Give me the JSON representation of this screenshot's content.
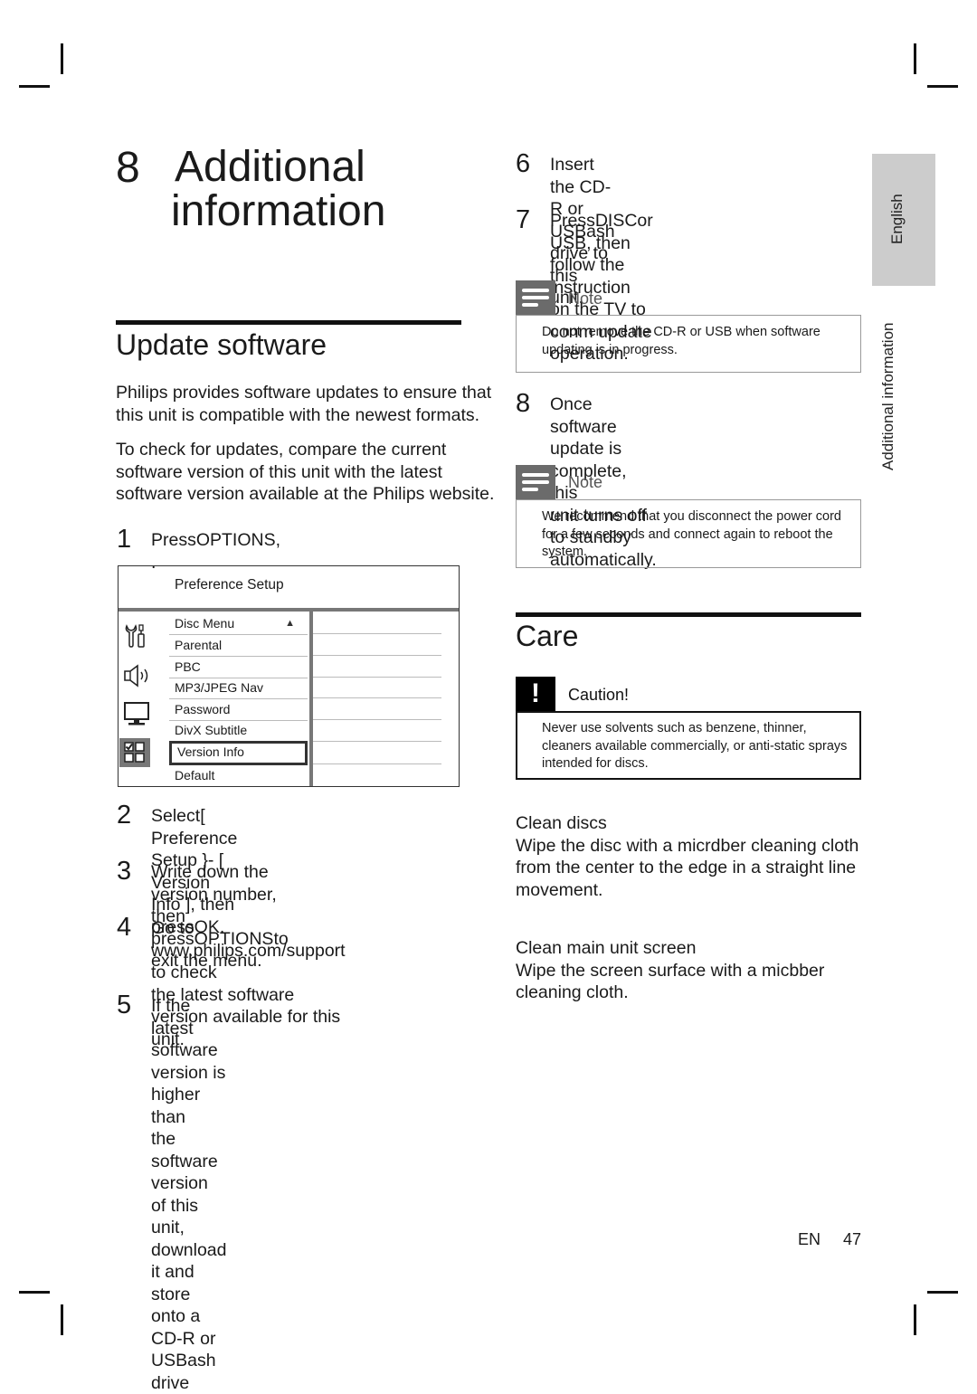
{
  "chapter": {
    "number": "8",
    "title_line1": "Additional",
    "title_line2": "information"
  },
  "side_tabs": {
    "language": "English",
    "section": "Additional information"
  },
  "update_software": {
    "title": "Update software",
    "para1_line1": "Philips provides software updates to ensure that",
    "para1_line2": "this unit is compatible with the newest formats.",
    "para2_line1": "To check for updates, compare the current",
    "para2_line2": "software version of this unit with the latest",
    "para2_line3": "software version available at the Philips website.",
    "steps": [
      {
        "num": "1",
        "lines": [
          "PressOPTIONS, ."
        ]
      },
      {
        "num": "2",
        "lines": [
          "Select[ Preference Setup }- [ Version",
          "Info ], then pressOK."
        ]
      },
      {
        "num": "3",
        "lines": [
          "Write down the version number, then",
          "pressOPTIONSto exit the menu."
        ]
      },
      {
        "num": "4",
        "lines": [
          "Go to www.philips.com/support to check",
          "the latest software version available for this",
          "unit."
        ]
      },
      {
        "num": "5",
        "lines": [
          "If the latest software version is higher than",
          "the software version of this unit, download",
          "it and store onto a CD-R or USBash",
          "drive"
        ]
      },
      {
        "num": "6",
        "lines": [
          "Insert the CD-R or USBash drive to this",
          "unit."
        ]
      },
      {
        "num": "7",
        "lines": [
          "PressDISCor USB, then follow the",
          "instruction on the TV to conm update",
          "operation."
        ]
      },
      {
        "num": "8",
        "lines": [
          "Once software update is complete, this",
          "unit turns off to standby automatically."
        ]
      }
    ]
  },
  "menu": {
    "title": "Preference Setup",
    "items": [
      "Disc Menu",
      "Parental",
      "PBC",
      "MP3/JPEG Nav",
      "Password",
      "DivX Subtitle",
      "Version Info",
      "Default"
    ],
    "selected": "Version Info",
    "scroll_indicator": "▲",
    "icons": [
      "tools-icon",
      "speaker-icon",
      "monitor-icon",
      "preferences-grid-icon"
    ]
  },
  "notes": [
    {
      "label": "Note",
      "lines": [
        "Do not remove the CD-R or USB when software",
        "updating is in progress."
      ]
    },
    {
      "label": "Note",
      "lines": [
        "We recommend that you disconnect the power cord",
        "for a few seconds and connect again to reboot the",
        "system."
      ]
    }
  ],
  "care": {
    "title": "Care",
    "caution": {
      "symbol": "!",
      "label": "Caution!",
      "lines": [
        "Never use solvents such as benzene, thinner,",
        "cleaners available commercially, or anti-static sprays",
        "intended for discs."
      ]
    },
    "clean_discs": {
      "heading": "Clean discs",
      "lines": [
        "Wipe the disc with a micrdber cleaning cloth",
        "from the center to the edge in a straight line",
        "movement."
      ]
    },
    "clean_screen": {
      "heading": "Clean main unit screen",
      "lines": [
        "Wipe the screen surface with a micbber",
        "cleaning cloth."
      ]
    }
  },
  "footer": {
    "lang": "EN",
    "page": "47"
  }
}
